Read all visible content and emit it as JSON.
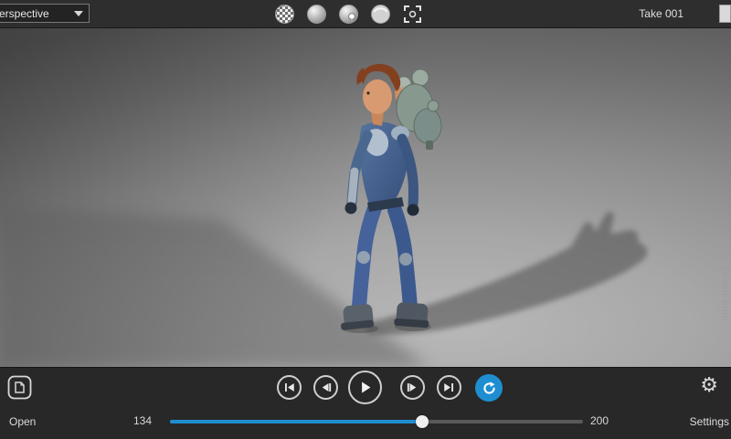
{
  "top_bar": {
    "view_dropdown": {
      "label": "Perspective"
    },
    "take_dropdown": {
      "label": "Take 001"
    },
    "display_modes": [
      {
        "icon": "textured-sphere-icon"
      },
      {
        "icon": "shaded-sphere-icon"
      },
      {
        "icon": "lit-sphere-icon"
      },
      {
        "icon": "flat-sphere-icon"
      },
      {
        "icon": "frame-selection-icon"
      }
    ]
  },
  "viewport": {
    "watermark": "www.3sxdn.com",
    "content": "3d-character-with-jetpack"
  },
  "playback": {
    "buttons": [
      "go-to-start",
      "step-back",
      "play",
      "step-forward",
      "go-to-end",
      "loop"
    ]
  },
  "timeline": {
    "start_label": "134",
    "end_label": "200",
    "progress_pct": 61
  },
  "footer": {
    "open_label": "Open",
    "settings_label": "Settings"
  },
  "colors": {
    "accent": "#1f8ed1",
    "topbar_bg": "#2e2e2e",
    "bottombar_bg": "#282828"
  }
}
